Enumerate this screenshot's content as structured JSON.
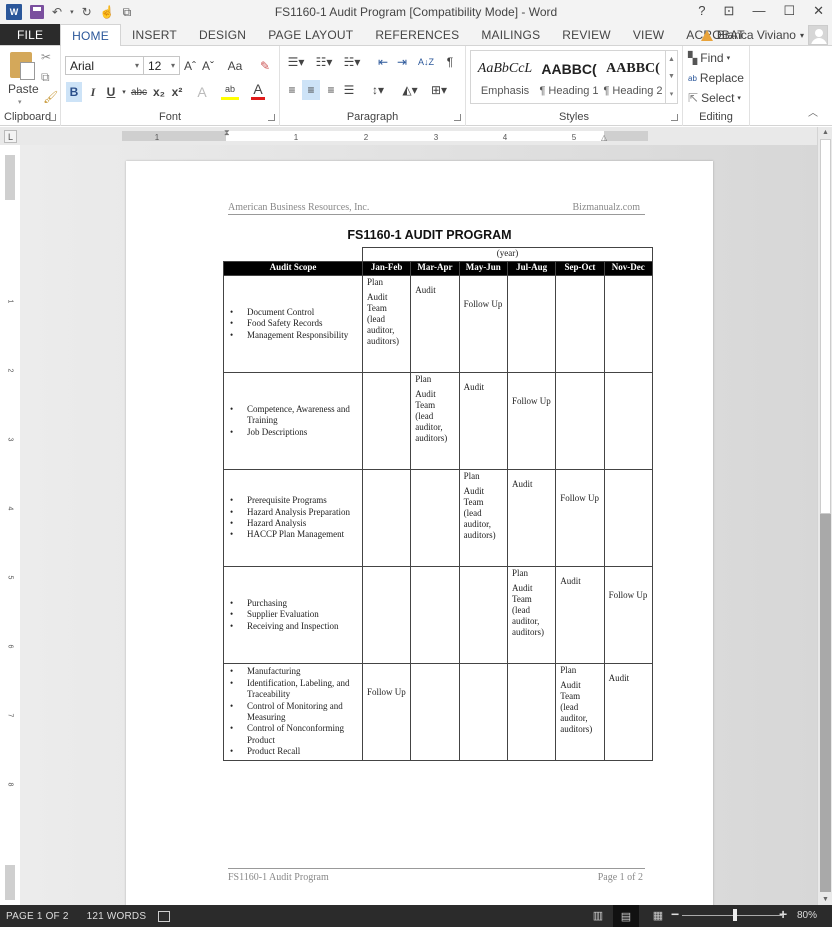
{
  "window": {
    "title": "FS1160-1 Audit Program [Compatibility Mode] - Word",
    "controls": [
      "help",
      "ribbon-display-options",
      "minimize",
      "maximize",
      "close"
    ],
    "help_label": "?"
  },
  "quick_access": {
    "app_icon": "W",
    "items": [
      "save-icon",
      "undo-icon",
      "redo-icon",
      "touch-mode-icon",
      "customize-icon"
    ]
  },
  "tabs": {
    "items": [
      {
        "label": "FILE"
      },
      {
        "label": "HOME",
        "active": true
      },
      {
        "label": "INSERT"
      },
      {
        "label": "DESIGN"
      },
      {
        "label": "PAGE LAYOUT"
      },
      {
        "label": "REFERENCES"
      },
      {
        "label": "MAILINGS"
      },
      {
        "label": "REVIEW"
      },
      {
        "label": "VIEW"
      },
      {
        "label": "ACROBAT"
      }
    ],
    "user_name": "Bianca Viviano"
  },
  "ribbon": {
    "clipboard": {
      "label": "Clipboard",
      "paste_label": "Paste"
    },
    "font": {
      "label": "Font",
      "font_name": "Arial",
      "font_size": "12",
      "grow": "Aˆ",
      "shrink": "Aˇ",
      "change_case": "Aa",
      "bold": "B",
      "italic": "I",
      "underline": "U",
      "strikethrough": "abc",
      "subscript": "x₂",
      "superscript": "x²",
      "text_effects": "A",
      "highlight": "ab",
      "font_color": "A",
      "highlight_color": "#ffff00",
      "font_color_value": "#e01b1b"
    },
    "paragraph": {
      "label": "Paragraph",
      "sort": "A↓Z",
      "pilcrow": "¶"
    },
    "styles": {
      "label": "Styles",
      "items": [
        {
          "sample": "AaBbCcL",
          "name": "Emphasis"
        },
        {
          "sample": "AABBC(",
          "name": "¶ Heading 1"
        },
        {
          "sample": "AABBC(",
          "name": "¶ Heading 2"
        }
      ]
    },
    "editing": {
      "label": "Editing",
      "find": "Find",
      "replace": "Replace",
      "select": "Select"
    }
  },
  "ruler": {
    "horizontal_ticks": [
      "1",
      "1",
      "2",
      "3",
      "4",
      "5"
    ],
    "vertical_ticks": [
      "1",
      "1",
      "2",
      "3",
      "4",
      "5",
      "6",
      "7",
      "8"
    ],
    "tab_selector": "L"
  },
  "document": {
    "header_left": "American Business Resources, Inc.",
    "header_right": "Bizmanualz.com",
    "title": "FS1160-1   AUDIT PROGRAM",
    "year_label": "(year)",
    "columns": [
      "Audit Scope",
      "Jan-Feb",
      "Mar-Apr",
      "May-Jun",
      "Jul-Aug",
      "Sep-Oct",
      "Nov-Dec"
    ],
    "rows": [
      {
        "scope": [
          "Document Control",
          "Food Safety Records",
          "Management Responsibility"
        ],
        "cells": [
          {
            "plan": "Plan",
            "text": "Audit Team (lead auditor, auditors)"
          },
          {
            "text": "Audit"
          },
          {
            "text": "Follow Up"
          },
          {
            "text": ""
          },
          {
            "text": ""
          },
          {
            "text": ""
          }
        ]
      },
      {
        "scope": [
          "Competence, Awareness and Training",
          "Job Descriptions"
        ],
        "cells": [
          {
            "text": ""
          },
          {
            "plan": "Plan",
            "text": "Audit Team (lead auditor, auditors)"
          },
          {
            "text": "Audit"
          },
          {
            "text": "Follow Up"
          },
          {
            "text": ""
          },
          {
            "text": ""
          }
        ]
      },
      {
        "scope": [
          "Prerequisite Programs",
          "Hazard Analysis Preparation",
          "Hazard Analysis",
          "HACCP Plan Management"
        ],
        "cells": [
          {
            "text": ""
          },
          {
            "text": ""
          },
          {
            "plan": "Plan",
            "text": "Audit Team (lead auditor, auditors)"
          },
          {
            "text": "Audit"
          },
          {
            "text": "Follow Up"
          },
          {
            "text": ""
          }
        ]
      },
      {
        "scope": [
          "Purchasing",
          "Supplier Evaluation",
          "Receiving and Inspection"
        ],
        "cells": [
          {
            "text": ""
          },
          {
            "text": ""
          },
          {
            "text": ""
          },
          {
            "plan": "Plan",
            "text": "Audit Team (lead auditor, auditors)"
          },
          {
            "text": "Audit"
          },
          {
            "text": "Follow Up"
          }
        ]
      },
      {
        "scope": [
          "Manufacturing",
          "Identification, Labeling, and Traceability",
          "Control of Monitoring and Measuring",
          "Control of Nonconforming Product",
          "Product Recall"
        ],
        "cells": [
          {
            "text": "Follow Up"
          },
          {
            "text": ""
          },
          {
            "text": ""
          },
          {
            "text": ""
          },
          {
            "plan": "Plan",
            "text": "Audit Team (lead auditor, auditors)"
          },
          {
            "text": "Audit"
          }
        ]
      }
    ],
    "footer_left": "FS1160-1 Audit Program",
    "footer_right": "Page 1 of 2"
  },
  "statusbar": {
    "page": "PAGE 1 OF 2",
    "words": "121 WORDS",
    "zoom_level": "80%",
    "zoom_percent": 80,
    "view_modes": [
      "read-mode",
      "print-layout",
      "web-layout"
    ],
    "active_view": "print-layout"
  },
  "scrollbar": {
    "position_fraction": 0.0,
    "visible_fraction": 0.5
  }
}
